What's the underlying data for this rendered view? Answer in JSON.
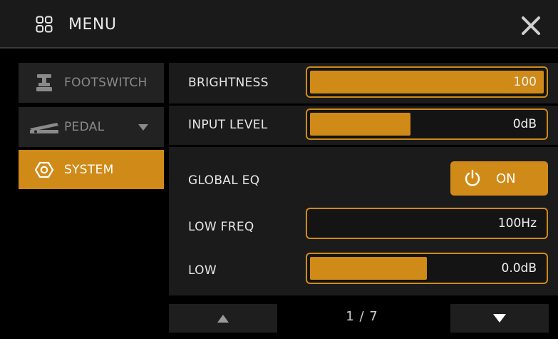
{
  "header": {
    "title": "MENU"
  },
  "sidebar": {
    "items": [
      {
        "label": "FOOTSWITCH",
        "icon": "footswitch-icon",
        "active": false
      },
      {
        "label": "PEDAL",
        "icon": "pedal-icon",
        "active": false
      },
      {
        "label": "SYSTEM",
        "icon": "hexagon-icon",
        "active": true
      }
    ]
  },
  "params": {
    "brightness": {
      "label": "BRIGHTNESS",
      "value": "100",
      "level": 1.0
    },
    "input_level": {
      "label": "INPUT LEVEL",
      "value": "0dB",
      "level": 0.43
    },
    "global_eq": {
      "label": "GLOBAL EQ",
      "value": "ON"
    },
    "low_freq": {
      "label": "LOW FREQ",
      "value": "100Hz",
      "level": 0.0
    },
    "low": {
      "label": "LOW",
      "value": "0.0dB",
      "level": 0.5
    }
  },
  "pager": {
    "indicator": "1 / 7"
  },
  "colors": {
    "accent": "#d08a17",
    "panel": "#1b1b1b",
    "background": "#000000"
  }
}
